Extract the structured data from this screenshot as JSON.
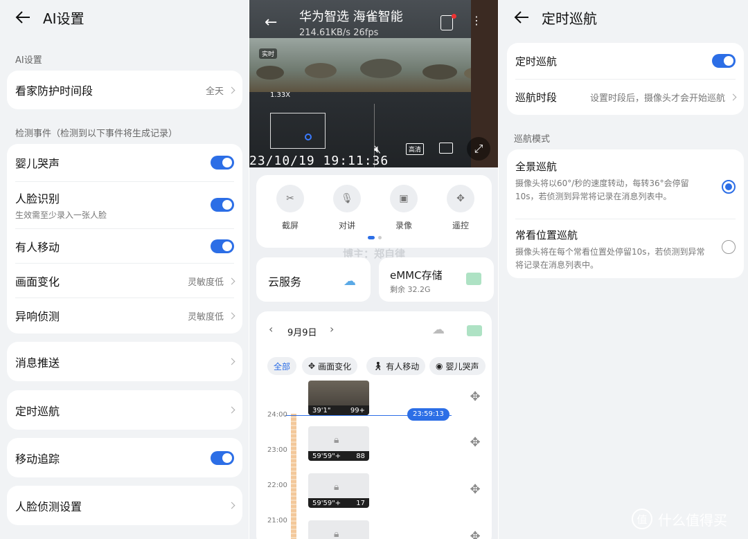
{
  "panel1": {
    "title": "AI设置",
    "section1": "AI设置",
    "home_guard": {
      "label": "看家防护时间段",
      "value": "全天"
    },
    "section2": "检测事件（检测到以下事件将生成记录）",
    "events": [
      {
        "label": "婴儿哭声",
        "type": "toggle",
        "on": true
      },
      {
        "label": "人脸识别",
        "sub": "生效需至少录入一张人脸",
        "type": "toggle",
        "on": true
      },
      {
        "label": "有人移动",
        "type": "toggle",
        "on": true
      },
      {
        "label": "画面变化",
        "type": "value",
        "value": "灵敏度低"
      },
      {
        "label": "异响侦测",
        "type": "value",
        "value": "灵敏度低"
      }
    ],
    "push": "消息推送",
    "cruise": "定时巡航",
    "tracking": {
      "label": "移动追踪",
      "on": true
    },
    "face_settings": "人脸侦测设置"
  },
  "panel2": {
    "device_name": "华为智选 海雀智能",
    "stats": "214.61KB/s  26fps",
    "live_badge": "实时",
    "zoom": "1.33X",
    "timestamp": "23/10/19  19:11:36",
    "hd_label": "高清",
    "controls": [
      {
        "label": "截屏",
        "icon": "screenshot-icon"
      },
      {
        "label": "对讲",
        "icon": "mic-icon"
      },
      {
        "label": "录像",
        "icon": "record-icon"
      },
      {
        "label": "遥控",
        "icon": "remote-icon"
      }
    ],
    "blogger": "博主：郑自律",
    "cloud": "云服务",
    "storage": {
      "title": "eMMC存储",
      "sub": "剩余 32.2G"
    },
    "date": "9月9日",
    "chips": [
      "全部",
      "画面变化",
      "有人移动",
      "婴儿哭声"
    ],
    "now_time": "23:59:13",
    "hours": [
      "24:00",
      "23:00",
      "22:00",
      "21:00"
    ],
    "clips": [
      {
        "left": "39'1\"",
        "right": "99+"
      },
      {
        "left": "59'59\"+",
        "right": "88"
      },
      {
        "left": "59'59\"+",
        "right": "17"
      }
    ]
  },
  "panel3": {
    "title": "定时巡航",
    "cruise_label": "定时巡航",
    "cruise_on": true,
    "period": {
      "label": "巡航时段",
      "value": "设置时段后，摄像头才会开始巡航"
    },
    "mode_section": "巡航模式",
    "modes": [
      {
        "title": "全景巡航",
        "desc": "摄像头将以60°/秒的速度转动，每转36°会停留10s，若侦测到异常将记录在消息列表中。",
        "selected": true
      },
      {
        "title": "常看位置巡航",
        "desc": "摄像头将在每个常看位置处停留10s，若侦测到异常将记录在消息列表中。",
        "selected": false
      }
    ]
  },
  "watermark": {
    "logo": "值",
    "text": "什么值得买"
  },
  "colors": {
    "accent": "#2c6ee6",
    "bg": "#f1f3f5"
  }
}
